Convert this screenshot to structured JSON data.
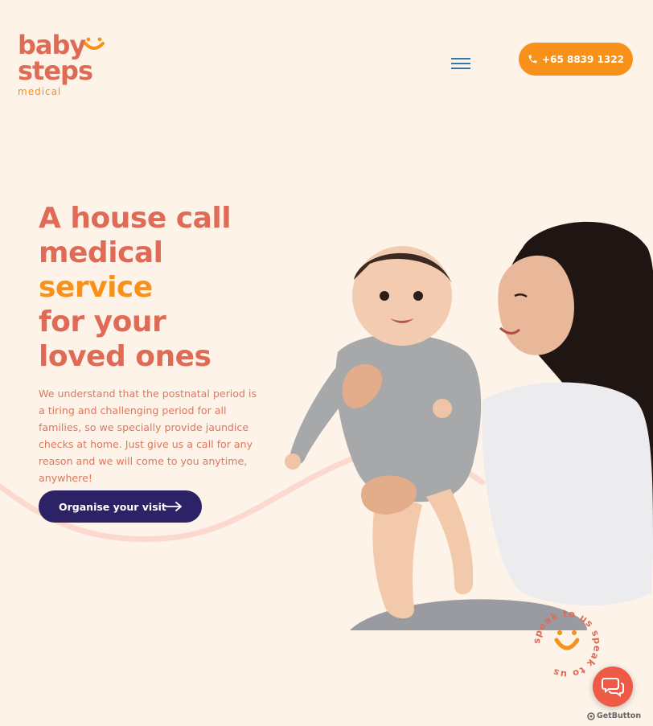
{
  "header": {
    "logo": {
      "line1": "baby",
      "line2": "steps",
      "line3": "medical"
    },
    "menu_icon": "hamburger-menu-icon",
    "phone_label": "+65 8839 1322",
    "phone_icon": "phone-icon"
  },
  "hero": {
    "title_line1": "A house call",
    "title_line2": "medical",
    "title_line3": "service",
    "title_line4": "for your",
    "title_line5": "loved ones",
    "description": "We understand that the postnatal period is a tiring and challenging period for all families, so we specially provide jaundice checks at home. Just give us a call for any reason and we will come to you anytime, anywhere!",
    "cta_label": "Organise your visit",
    "cta_icon": "arrow-right-icon"
  },
  "speak_badge": {
    "text": "speak to us speak to us"
  },
  "chat": {
    "icon": "chat-bubbles-icon",
    "powered_by": "GetButton"
  },
  "colors": {
    "background": "#fdf3e8",
    "brand_coral": "#df6b57",
    "brand_orange": "#f7911a",
    "cta_navy": "#2c2265",
    "chat_red": "#ee5a45",
    "menu_blue": "#3376a8"
  }
}
